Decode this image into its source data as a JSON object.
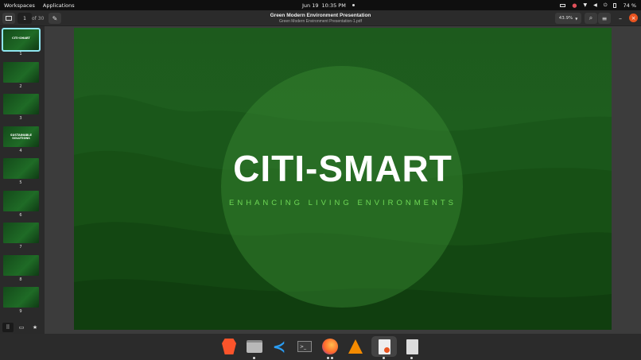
{
  "topbar": {
    "workspaces": "Workspaces",
    "applications": "Applications",
    "date": "Jun 19",
    "time": "10:35 PM",
    "battery": "74 %"
  },
  "header": {
    "page_current": "1",
    "page_total": "of 30",
    "title": "Green Modern Environment Presentation",
    "subtitle": "Green Modern Environment Presentation-1.pdf",
    "zoom": "43.9%"
  },
  "sidebar": {
    "thumbnails": [
      {
        "num": "1",
        "label": "CITI-SMART",
        "active": true
      },
      {
        "num": "2",
        "label": ""
      },
      {
        "num": "3",
        "label": ""
      },
      {
        "num": "4",
        "label": "SUSTAINABLE SOLUTIONS"
      },
      {
        "num": "5",
        "label": ""
      },
      {
        "num": "6",
        "label": ""
      },
      {
        "num": "7",
        "label": ""
      },
      {
        "num": "8",
        "label": ""
      },
      {
        "num": "9",
        "label": ""
      }
    ]
  },
  "slide": {
    "title": "CITI-SMART",
    "tagline": "ENHANCING LIVING ENVIRONMENTS"
  },
  "dock": {
    "apps": [
      "brave-browser-icon",
      "files-icon",
      "vscode-icon",
      "terminal-icon",
      "firefox-icon",
      "vlc-icon",
      "document-viewer-icon",
      "text-document-icon"
    ]
  },
  "colors": {
    "accent_close": "#e95420",
    "slide_green": "#1e5f1e",
    "tagline_green": "#6fd957",
    "active_thumb": "#8fe5f0"
  }
}
